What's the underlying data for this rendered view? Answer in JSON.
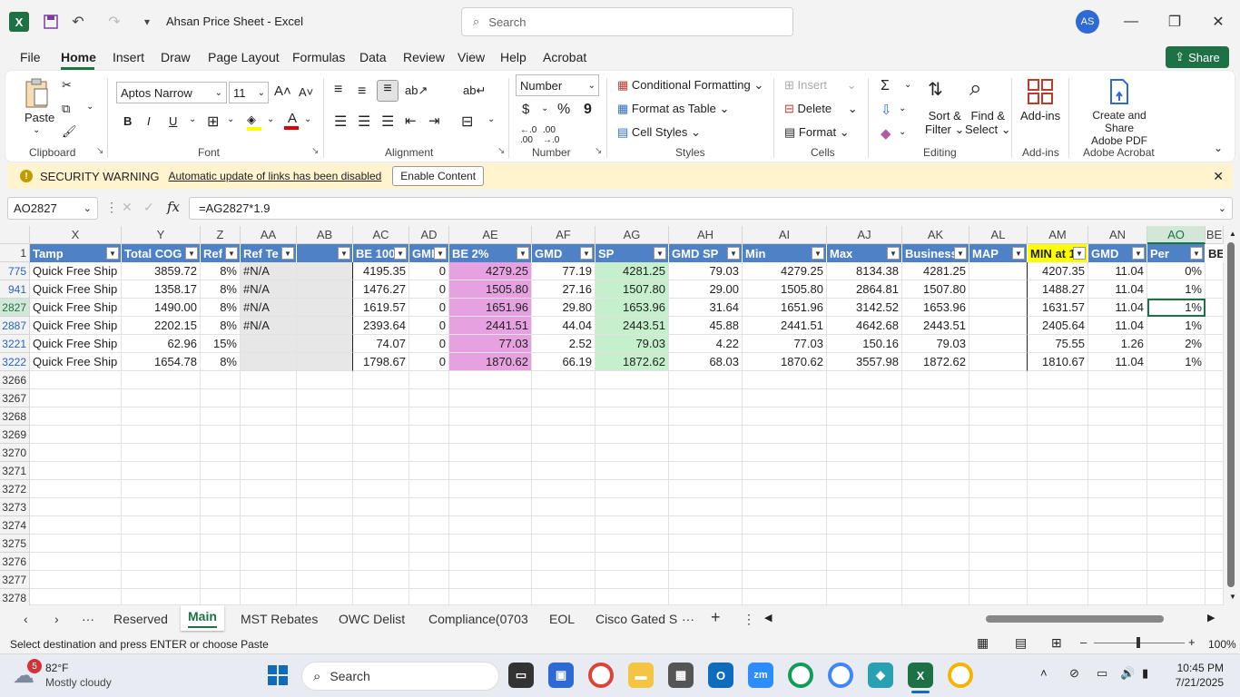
{
  "app": {
    "title": "Ahsan Price Sheet  -  Excel",
    "search_placeholder": "Search",
    "avatar": "AS",
    "share_label": "Share"
  },
  "menu": [
    "File",
    "Home",
    "Insert",
    "Draw",
    "Page Layout",
    "Formulas",
    "Data",
    "Review",
    "View",
    "Help",
    "Acrobat"
  ],
  "ribbon": {
    "paste": "Paste",
    "clipboard": "Clipboard",
    "font_name": "Aptos Narrow",
    "font_size": "11",
    "font_group": "Font",
    "alignment_group": "Alignment",
    "number_format": "Number",
    "number_group": "Number",
    "conditional_formatting": "Conditional Formatting",
    "format_as_table": "Format as Table",
    "cell_styles": "Cell Styles",
    "styles_group": "Styles",
    "insert": "Insert",
    "delete": "Delete",
    "format": "Format",
    "cells_group": "Cells",
    "sort_filter": "Sort &",
    "sort_filter2": "Filter",
    "find_select": "Find &",
    "find_select2": "Select",
    "editing_group": "Editing",
    "addins": "Add-ins",
    "addins_group": "Add-ins",
    "create_share": "Create and Share",
    "adobe_pdf": "Adobe PDF",
    "adobe_group": "Adobe Acrobat"
  },
  "security": {
    "title": "SECURITY WARNING",
    "message": "Automatic update of links has been disabled",
    "button": "Enable Content"
  },
  "formula": {
    "namebox": "AO2827",
    "fx": "fx",
    "formula": "=AG2827*1.9"
  },
  "columns": [
    "X",
    "Y",
    "Z",
    "AA",
    "AB",
    "AC",
    "AD",
    "AE",
    "AF",
    "AG",
    "AH",
    "AI",
    "AJ",
    "AK",
    "AL",
    "AM",
    "AN",
    "AO",
    "BE"
  ],
  "headers": [
    "Tamp",
    "Total COG",
    "Ref",
    "Ref Te",
    "",
    "BE 100",
    "GMI",
    "BE 2%",
    "GMD",
    "SP",
    "GMD SP",
    "Min",
    "Max",
    "Business",
    "MAP",
    "MIN at 1",
    "GMD",
    "Per",
    "BE"
  ],
  "rows": [
    {
      "num": "775",
      "cells": [
        "Quick Free Ship",
        "3859.72",
        "8%",
        "#N/A",
        "",
        "4195.35",
        "0",
        "4279.25",
        "77.19",
        "4281.25",
        "79.03",
        "4279.25",
        "8134.38",
        "4281.25",
        "",
        "4207.35",
        "11.04",
        "0%"
      ]
    },
    {
      "num": "941",
      "cells": [
        "Quick Free Ship",
        "1358.17",
        "8%",
        "#N/A",
        "",
        "1476.27",
        "0",
        "1505.80",
        "27.16",
        "1507.80",
        "29.00",
        "1505.80",
        "2864.81",
        "1507.80",
        "",
        "1488.27",
        "11.04",
        "1%"
      ]
    },
    {
      "num": "2827",
      "cells": [
        "Quick Free Ship",
        "1490.00",
        "8%",
        "#N/A",
        "",
        "1619.57",
        "0",
        "1651.96",
        "29.80",
        "1653.96",
        "31.64",
        "1651.96",
        "3142.52",
        "1653.96",
        "",
        "1631.57",
        "11.04",
        "1%"
      ]
    },
    {
      "num": "2887",
      "cells": [
        "Quick Free Ship",
        "2202.15",
        "8%",
        "#N/A",
        "",
        "2393.64",
        "0",
        "2441.51",
        "44.04",
        "2443.51",
        "45.88",
        "2441.51",
        "4642.68",
        "2443.51",
        "",
        "2405.64",
        "11.04",
        "1%"
      ]
    },
    {
      "num": "3221",
      "cells": [
        "Quick Free Ship",
        "62.96",
        "15%",
        "",
        "",
        "74.07",
        "0",
        "77.03",
        "2.52",
        "79.03",
        "4.22",
        "77.03",
        "150.16",
        "79.03",
        "",
        "75.55",
        "1.26",
        "2%"
      ]
    },
    {
      "num": "3222",
      "cells": [
        "Quick Free Ship",
        "1654.78",
        "8%",
        "",
        "",
        "1798.67",
        "0",
        "1870.62",
        "66.19",
        "1872.62",
        "68.03",
        "1870.62",
        "3557.98",
        "1872.62",
        "",
        "1810.67",
        "11.04",
        "1%"
      ]
    }
  ],
  "empty_rows": [
    "3266",
    "3267",
    "3268",
    "3269",
    "3270",
    "3271",
    "3272",
    "3273",
    "3274",
    "3275",
    "3276",
    "3277",
    "3278"
  ],
  "header_row_num": "1",
  "sheets": [
    "Reserved",
    "Main",
    "MST Rebates",
    "OWC Delist",
    "Compliance(0703",
    "EOL",
    "Cisco Gated S"
  ],
  "status": {
    "message": "Select destination and press ENTER or choose Paste",
    "zoom": "100%"
  },
  "taskbar": {
    "weather_temp": "82°F",
    "weather_desc": "Mostly cloudy",
    "weather_badge": "5",
    "search": "Search",
    "time": "10:45 PM",
    "date": "7/21/2025"
  },
  "colors": {
    "header_blue": "#4f81c7",
    "pink": "#e6a2e0",
    "green": "#c6efce",
    "yellow": "#ffff00",
    "excel_green": "#1e7145"
  }
}
